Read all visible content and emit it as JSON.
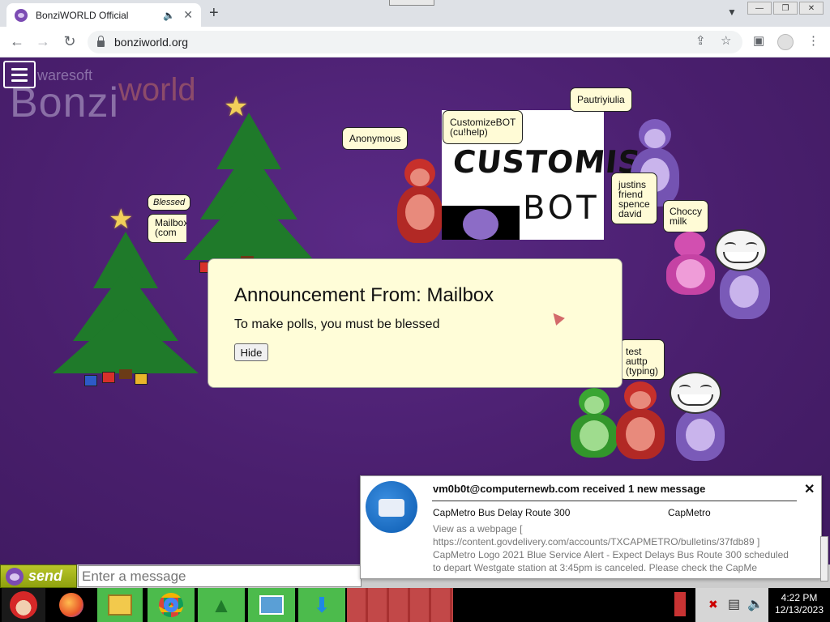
{
  "browser": {
    "tab_title": "BonziWORLD Official",
    "tab_audio_icon": "speaker-icon",
    "tab_close": "✕",
    "new_tab": "+",
    "url": "bonziworld.org"
  },
  "page": {
    "logo_small": "waresoft",
    "logo_big": "Bonzi",
    "logo_world": "world",
    "bubbles": {
      "blessed": "Blessed",
      "mailbox": "Mailbox\n(com",
      "anonymous": "Anonymous",
      "customizebot": "CustomizeBOT\n(cu!help)",
      "pautriyiulia": "Pautriyiulia",
      "justins": "justins\nfriend\nspence\ndavid",
      "choccy": "Choccy\nmilk",
      "test": "test\nauttp\n(typing)"
    },
    "customize_art_line1": "CUSTOMISE",
    "customize_art_line2": "BOT",
    "announcement": {
      "title": "Announcement From: Mailbox",
      "message": "To make polls, you must be blessed",
      "hide_label": "Hide"
    }
  },
  "chat": {
    "send_label": "send",
    "placeholder": "Enter a message"
  },
  "notification": {
    "header": "vm0b0t@computernewb.com received 1 new message",
    "subject": "CapMetro Bus Delay Route 300",
    "from": "CapMetro",
    "body": "View as a webpage [ https://content.govdelivery.com/accounts/TXCAPMETRO/bulletins/37fdb89 ] CapMetro Logo 2021 Blue Service Alert - Expect Delays Bus Route 300 scheduled to depart Westgate station at 3:45pm is canceled. Please check the CapMe",
    "close": "✕"
  },
  "taskbar": {
    "time": "4:22 PM",
    "date": "12/13/2023"
  },
  "colors": {
    "page_bg": "#4b2170",
    "bubble_bg": "#fffbd6",
    "announcement_bg": "#fffdd8",
    "send_green": "#9db318"
  }
}
